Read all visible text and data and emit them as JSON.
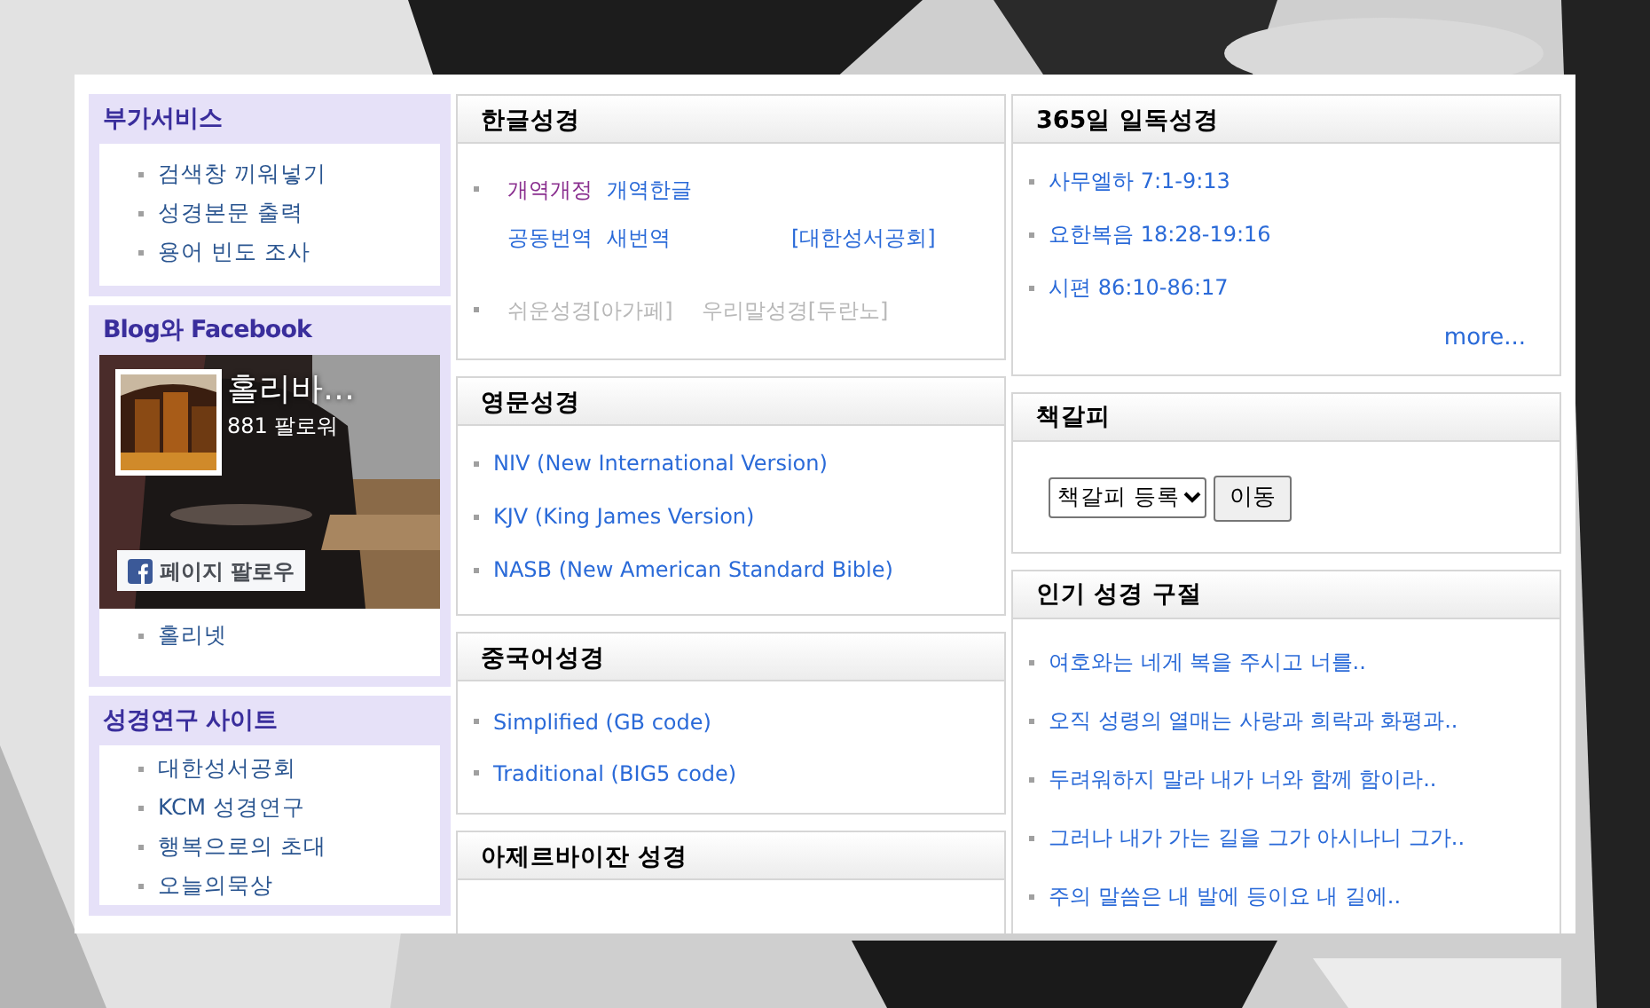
{
  "sidebar": [
    {
      "kind": "links",
      "title": "부가서비스",
      "items": [
        "검색창 끼워넣기",
        "성경본문 출력",
        "용어 빈도 조사"
      ]
    },
    {
      "kind": "facebook",
      "title": "Blog와 Facebook",
      "page_name": "홀리바…",
      "followers": "881 팔로워",
      "follow_button": "페이지 팔로우",
      "items": [
        "홀리넷"
      ]
    },
    {
      "kind": "links",
      "title": "성경연구 사이트",
      "items": [
        "대한성서공회",
        "KCM 성경연구",
        "행복으로의 초대",
        "오늘의묵상"
      ]
    }
  ],
  "middle": [
    {
      "title": "한글성경",
      "kind": "groups",
      "groups": [
        {
          "lines": [
            [
              {
                "text": "개역개정",
                "kind": "visited"
              },
              {
                "text": "개역한글",
                "kind": "link"
              }
            ],
            [
              {
                "text": "공동번역",
                "kind": "link"
              },
              {
                "text": "새번역",
                "kind": "link"
              },
              {
                "text": "[대한성서공회]",
                "kind": "link"
              }
            ]
          ]
        },
        {
          "lines": [
            [
              {
                "text": "쉬운성경[아가페]",
                "kind": "disabled"
              },
              {
                "text": "우리말성경[두란노]",
                "kind": "disabled"
              }
            ]
          ]
        }
      ]
    },
    {
      "title": "영문성경",
      "kind": "list",
      "items": [
        "NIV (New International Version)",
        "KJV (King James Version)",
        "NASB (New American Standard Bible)"
      ]
    },
    {
      "title": "중국어성경",
      "kind": "list",
      "items": [
        "Simplified (GB code)",
        "Traditional (BIG5 code)"
      ]
    },
    {
      "title": "아제르바이잔 성경",
      "kind": "list"
    }
  ],
  "right": [
    {
      "title": "365일 일독성경",
      "kind": "list",
      "items": [
        "사무엘하 7:1-9:13",
        "요한복음 18:28-19:16",
        "시편 86:10-86:17"
      ],
      "more": "more..."
    },
    {
      "title": "책갈피",
      "kind": "bookmark",
      "select": "책갈피 등록",
      "button": "이동"
    },
    {
      "title": "인기 성경 구절",
      "kind": "list",
      "items": [
        "여호와는 네게 복을 주시고 너를..",
        "오직 성령의 열매는 사랑과 희락과 화평과..",
        "두려워하지 말라 내가 너와 함께 함이라..",
        "그러나 내가 가는 길을 그가 아시나니 그가..",
        "주의 말씀은 내 발에 등이요 내 길에.."
      ]
    }
  ]
}
